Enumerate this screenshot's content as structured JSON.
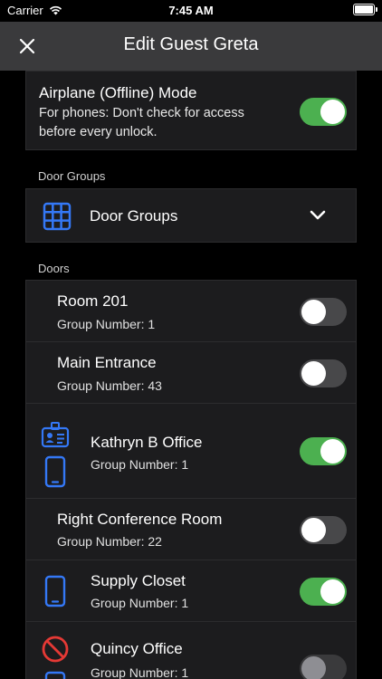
{
  "status": {
    "carrier": "Carrier",
    "time": "7:45 AM"
  },
  "nav": {
    "title": "Edit Guest Greta"
  },
  "airplane": {
    "title": "Airplane (Offline) Mode",
    "line1": "For phones: Don't check for access",
    "line2": "before every unlock.",
    "enabled": true
  },
  "door_groups": {
    "section_label": "Door Groups",
    "select_label": "Door Groups"
  },
  "doors": {
    "section_label": "Doors",
    "items": [
      {
        "name": "Room 201",
        "group": "Group Number: 1",
        "enabled": false,
        "icons": []
      },
      {
        "name": "Main Entrance",
        "group": "Group Number: 43",
        "enabled": false,
        "icons": []
      },
      {
        "name": "Kathryn B Office",
        "group": "Group Number: 1",
        "enabled": true,
        "icons": [
          "badge-icon",
          "phone-icon"
        ]
      },
      {
        "name": "Right Conference Room",
        "group": "Group Number: 22",
        "enabled": false,
        "icons": []
      },
      {
        "name": "Supply Closet",
        "group": "Group Number: 1",
        "enabled": true,
        "icons": [
          "phone-icon"
        ]
      },
      {
        "name": "Quincy Office",
        "group": "Group Number: 1",
        "enabled": false,
        "icons": [
          "no-access-icon",
          "phone-icon"
        ]
      }
    ]
  },
  "colors": {
    "accent": "#4cb050",
    "icon_blue": "#3478f6",
    "icon_red": "#e53935"
  }
}
